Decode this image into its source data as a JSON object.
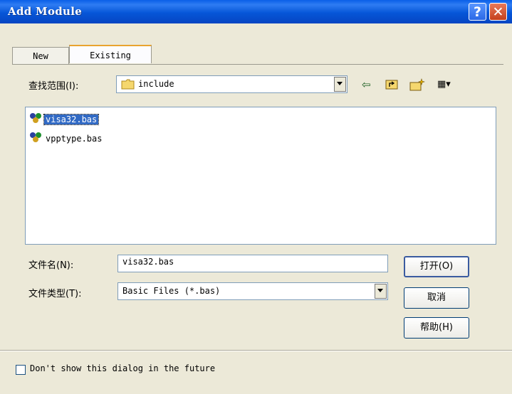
{
  "window": {
    "title": "Add Module",
    "help_glyph": "?",
    "close_glyph": "✕"
  },
  "tabs": [
    {
      "label": "New"
    },
    {
      "label": "Existing"
    }
  ],
  "lookin": {
    "label": "查找范围(I):",
    "value": "include"
  },
  "toolbar": {
    "back_glyph": "⇦",
    "up_glyph": "⮤",
    "newfolder_glyph": "✦",
    "views_glyph": "▦▾"
  },
  "files": [
    {
      "name": "visa32.bas",
      "selected": true
    },
    {
      "name": "vpptype.bas",
      "selected": false
    }
  ],
  "filename": {
    "label": "文件名(N):",
    "value": "visa32.bas"
  },
  "filetype": {
    "label": "文件类型(T):",
    "value": "Basic Files (*.bas)"
  },
  "buttons": {
    "open": "打开(O)",
    "cancel": "取消",
    "help": "帮助(H)"
  },
  "dont_show": {
    "label": "Don't show this dialog in the future",
    "checked": false
  },
  "icons": {
    "folder": "folder-icon",
    "module": "vb-module-icon"
  },
  "colors": {
    "titlebar": "#0a5fe8",
    "selection": "#316ac5",
    "face": "#ece9d8"
  }
}
